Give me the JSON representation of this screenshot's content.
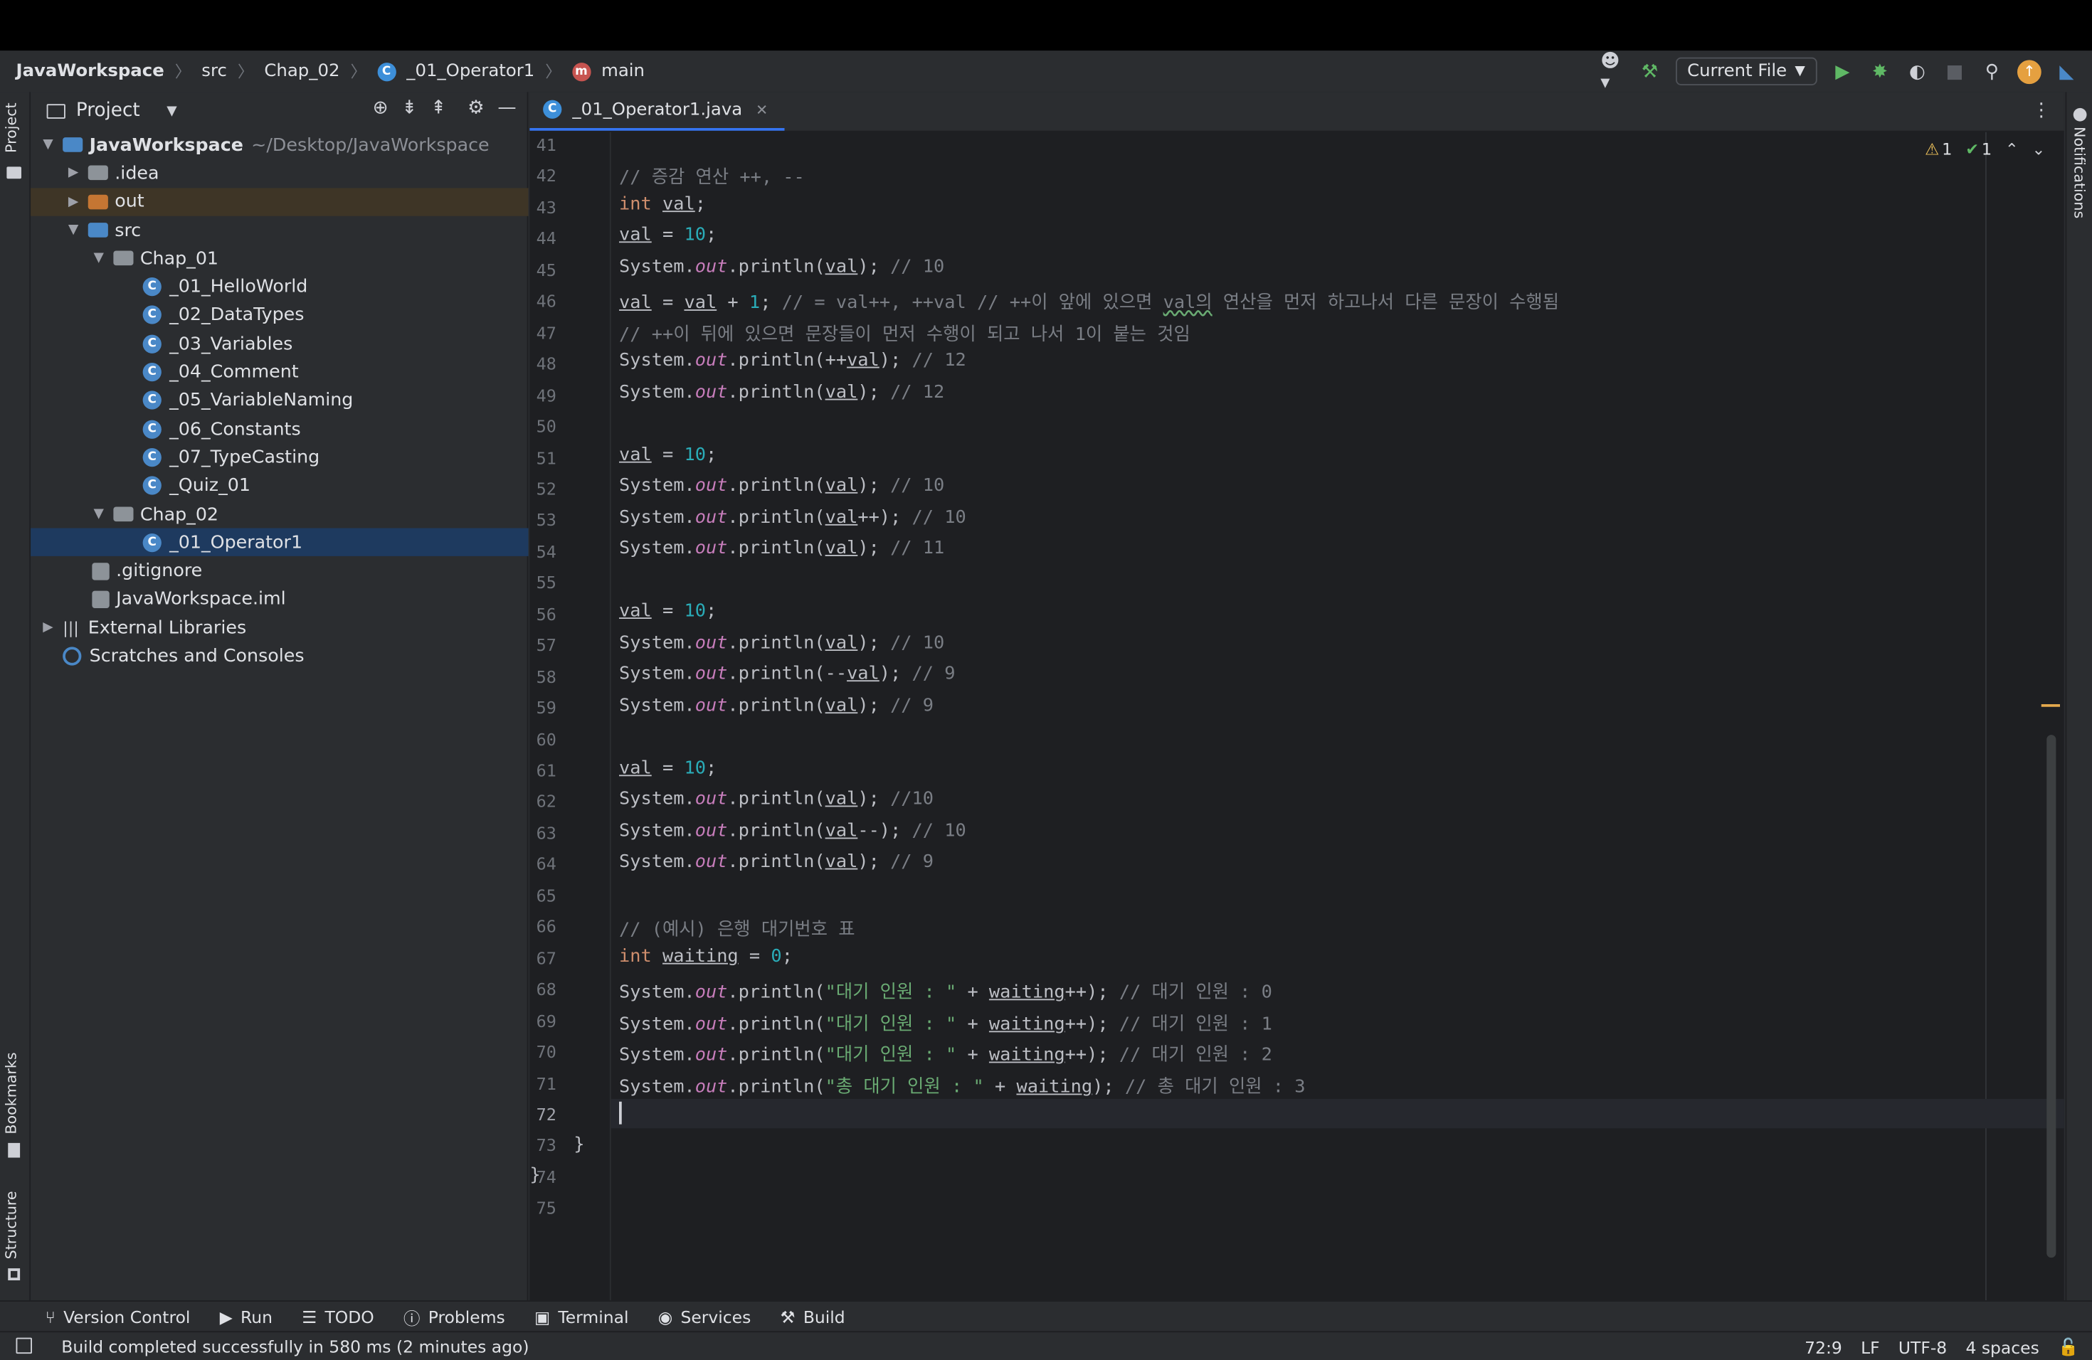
{
  "breadcrumb": {
    "project": "JavaWorkspace",
    "src": "src",
    "chap": "Chap_02",
    "file": "_01_Operator1",
    "method": "main"
  },
  "toolbar": {
    "run_config": "Current File"
  },
  "project_panel": {
    "title": "Project",
    "root_name": "JavaWorkspace",
    "root_path": "~/Desktop/JavaWorkspace",
    "items": {
      "idea": ".idea",
      "out": "out",
      "src": "src",
      "chap01": "Chap_01",
      "f1": "_01_HelloWorld",
      "f2": "_02_DataTypes",
      "f3": "_03_Variables",
      "f4": "_04_Comment",
      "f5": "_05_VariableNaming",
      "f6": "_06_Constants",
      "f7": "_07_TypeCasting",
      "f8": "_Quiz_01",
      "chap02": "Chap_02",
      "f9": "_01_Operator1",
      "gitignore": ".gitignore",
      "iml": "JavaWorkspace.iml",
      "extlib": "External Libraries",
      "scratch": "Scratches and Consoles"
    }
  },
  "sidebars": {
    "project": "Project",
    "bookmarks": "Bookmarks",
    "structure": "Structure",
    "notifications": "Notifications"
  },
  "editor": {
    "tab": "_01_Operator1.java",
    "warnings": "1",
    "oks": "1",
    "line_numbers": [
      "41",
      "42",
      "43",
      "44",
      "45",
      "46",
      "47",
      "48",
      "49",
      "50",
      "51",
      "52",
      "53",
      "54",
      "55",
      "56",
      "57",
      "58",
      "59",
      "60",
      "61",
      "62",
      "63",
      "64",
      "65",
      "66",
      "67",
      "68",
      "69",
      "70",
      "71",
      "72",
      "73",
      "74",
      "75"
    ],
    "code": {
      "l42": "// 증감 연산 ++, --",
      "l46_comment": "// = val++, ++val // ++이 앞에 있으면 ",
      "l46_tail": " 연산을 먼저 하고나서 다른 문장이 수행됨",
      "l46_var": "val의",
      "l47": "// ++이 뒤에 있으면 문장들이 먼저 수행이 되고 나서 1이 붙는 것임",
      "c10": "// 10",
      "c12": "// 12",
      "c11": "// 11",
      "c9": "// 9",
      "c10b": "//10",
      "l66": "// (예시) 은행 대기번호 표",
      "s_wait": "\"대기 인원 : \"",
      "s_total": "\"총 대기 인원 : \"",
      "c68": "// 대기 인원 : 0",
      "c69": "// 대기 인원 : 1",
      "c70": "// 대기 인원 : 2",
      "c71": "// 총 대기 인원 : 3"
    }
  },
  "bottom_tools": [
    "Version Control",
    "Run",
    "TODO",
    "Problems",
    "Terminal",
    "Services",
    "Build"
  ],
  "status": {
    "message": "Build completed successfully in 580 ms (2 minutes ago)",
    "position": "72:9",
    "line_sep": "LF",
    "encoding": "UTF-8",
    "indent": "4 spaces"
  }
}
